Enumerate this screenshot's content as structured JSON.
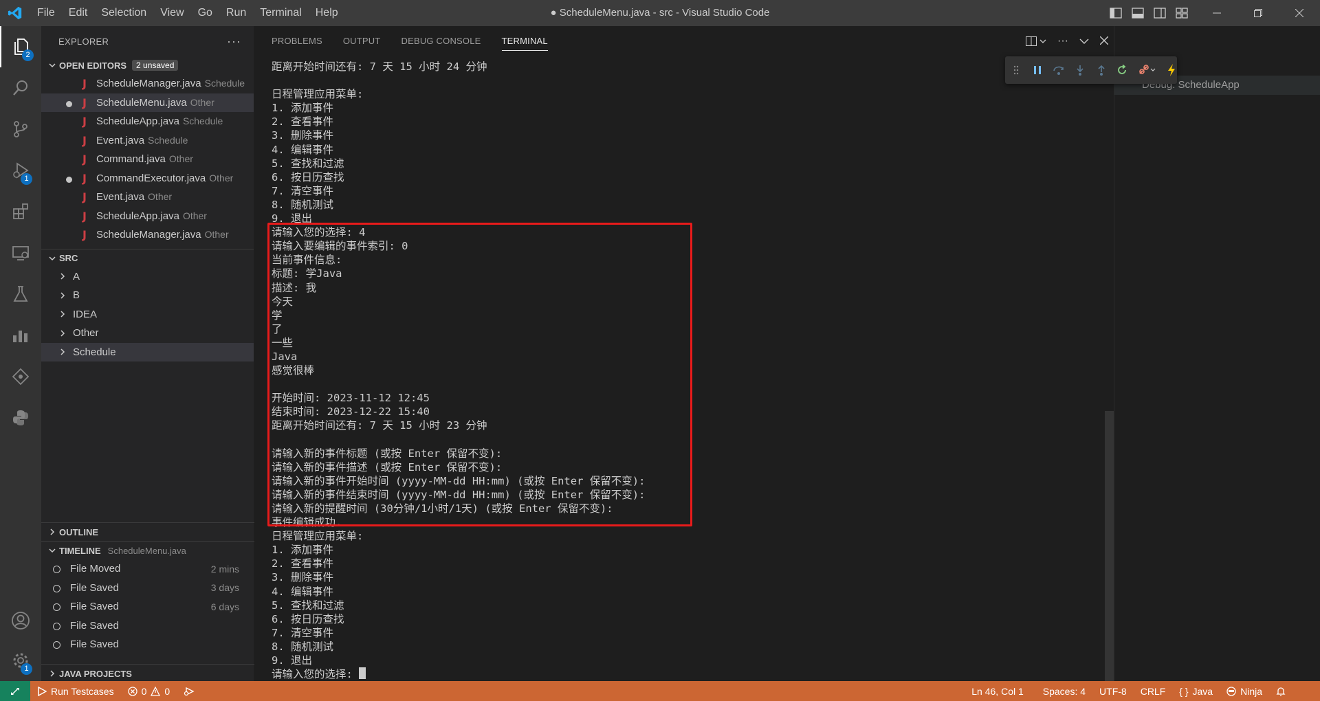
{
  "window": {
    "title": "● ScheduleMenu.java - src - Visual Studio Code",
    "menu": [
      "File",
      "Edit",
      "Selection",
      "View",
      "Go",
      "Run",
      "Terminal",
      "Help"
    ]
  },
  "activity": {
    "explorer_badge": "2",
    "debug_badge": "1",
    "settings_badge": "1"
  },
  "sidebar": {
    "title": "EXPLORER",
    "more": "···",
    "open_editors": {
      "label": "OPEN EDITORS",
      "badge": "2 unsaved",
      "items": [
        {
          "name": "ScheduleManager.java",
          "dir": "Schedule",
          "modified": false
        },
        {
          "name": "ScheduleMenu.java",
          "dir": "Other",
          "modified": true
        },
        {
          "name": "ScheduleApp.java",
          "dir": "Schedule",
          "modified": false
        },
        {
          "name": "Event.java",
          "dir": "Schedule",
          "modified": false
        },
        {
          "name": "Command.java",
          "dir": "Other",
          "modified": false
        },
        {
          "name": "CommandExecutor.java",
          "dir": "Other",
          "modified": true
        },
        {
          "name": "Event.java",
          "dir": "Other",
          "modified": false
        },
        {
          "name": "ScheduleApp.java",
          "dir": "Other",
          "modified": false
        },
        {
          "name": "ScheduleManager.java",
          "dir": "Other",
          "modified": false
        }
      ]
    },
    "src": {
      "label": "SRC",
      "folders": [
        "A",
        "B",
        "IDEA",
        "Other",
        "Schedule"
      ]
    },
    "outline": {
      "label": "OUTLINE"
    },
    "timeline": {
      "label": "TIMELINE",
      "file": "ScheduleMenu.java",
      "items": [
        {
          "label": "File Moved",
          "time": "2 mins"
        },
        {
          "label": "File Saved",
          "time": "3 days"
        },
        {
          "label": "File Saved",
          "time": "6 days"
        },
        {
          "label": "File Saved",
          "time": ""
        },
        {
          "label": "File Saved",
          "time": ""
        }
      ]
    },
    "java_projects": {
      "label": "JAVA PROJECTS"
    }
  },
  "panel": {
    "tabs": [
      "PROBLEMS",
      "OUTPUT",
      "DEBUG CONSOLE",
      "TERMINAL"
    ],
    "active_tab": "TERMINAL",
    "terminal_lines": [
      "距离开始时间还有: 7 天 15 小时 24 分钟",
      "",
      "日程管理应用菜单:",
      "1. 添加事件",
      "2. 查看事件",
      "3. 删除事件",
      "4. 编辑事件",
      "5. 查找和过滤",
      "6. 按日历查找",
      "7. 清空事件",
      "8. 随机测试",
      "9. 退出",
      "请输入您的选择: 4",
      "请输入要编辑的事件索引: 0",
      "当前事件信息:",
      "标题: 学Java",
      "描述: 我",
      "今天",
      "学",
      "了",
      "一些",
      "Java",
      "感觉很棒",
      "",
      "开始时间: 2023-11-12 12:45",
      "结束时间: 2023-12-22 15:40",
      "距离开始时间还有: 7 天 15 小时 23 分钟",
      "",
      "请输入新的事件标题 (或按 Enter 保留不变):",
      "请输入新的事件描述 (或按 Enter 保留不变):",
      "请输入新的事件开始时间 (yyyy-MM-dd HH:mm) (或按 Enter 保留不变):",
      "请输入新的事件结束时间 (yyyy-MM-dd HH:mm) (或按 Enter 保留不变):",
      "请输入新的提醒时间 (30分钟/1小时/1天) (或按 Enter 保留不变):",
      "事件编辑成功.",
      "日程管理应用菜单:",
      "1. 添加事件",
      "2. 查看事件",
      "3. 删除事件",
      "4. 编辑事件",
      "5. 查找和过滤",
      "6. 按日历查找",
      "7. 清空事件",
      "8. 随机测试",
      "9. 退出"
    ],
    "prompt": "请输入您的选择: "
  },
  "right_pane": {
    "item": "Debug: ScheduleApp"
  },
  "statusbar": {
    "run_testcases": "Run Testcases",
    "errors": "0",
    "warnings": "0",
    "position": "Ln 46, Col 1",
    "spaces": "Spaces: 4",
    "encoding": "UTF-8",
    "eol": "CRLF",
    "language": "Java",
    "ninja": "Ninja"
  },
  "colors": {
    "statusbar": "#cc6633",
    "remote": "#16825d",
    "highlight": "#e81b1b",
    "accent": "#0e70c0"
  }
}
